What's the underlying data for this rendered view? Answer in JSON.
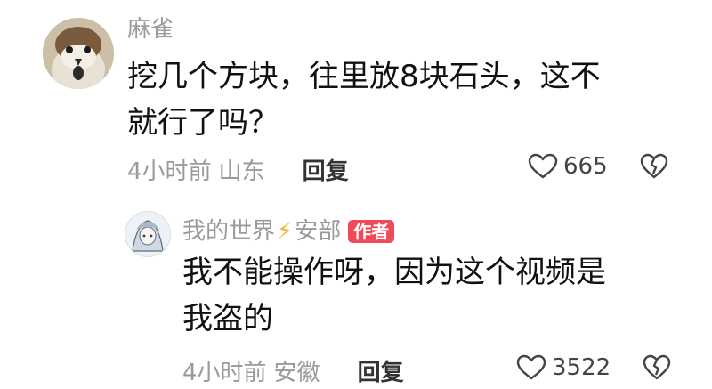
{
  "comment": {
    "avatar_icon": "sparrow-avatar",
    "username": "麻雀",
    "body_lines": [
      "挖几个方块，往里放8块石头，这不",
      "就行了吗？"
    ],
    "time": "4小时前",
    "location": "山东",
    "reply_label": "回复",
    "like_count": "665",
    "like_icon": "heart-outline-icon",
    "dislike_icon": "broken-heart-icon"
  },
  "reply": {
    "avatar_icon": "anime-character-avatar",
    "username_part1": "我的世界",
    "username_symbol": "⚡",
    "username_part2": "安部",
    "author_badge": "作者",
    "body_lines": [
      "我不能操作呀，因为这个视频是",
      "我盗的"
    ],
    "time": "4小时前",
    "location": "安徽",
    "reply_label": "回复",
    "like_count": "3522",
    "like_icon": "heart-outline-icon",
    "dislike_icon": "broken-heart-icon"
  },
  "colors": {
    "meta_gray": "#9a9a9a",
    "badge_red": "#f04a5a",
    "bolt_yellow": "#f2b632"
  }
}
